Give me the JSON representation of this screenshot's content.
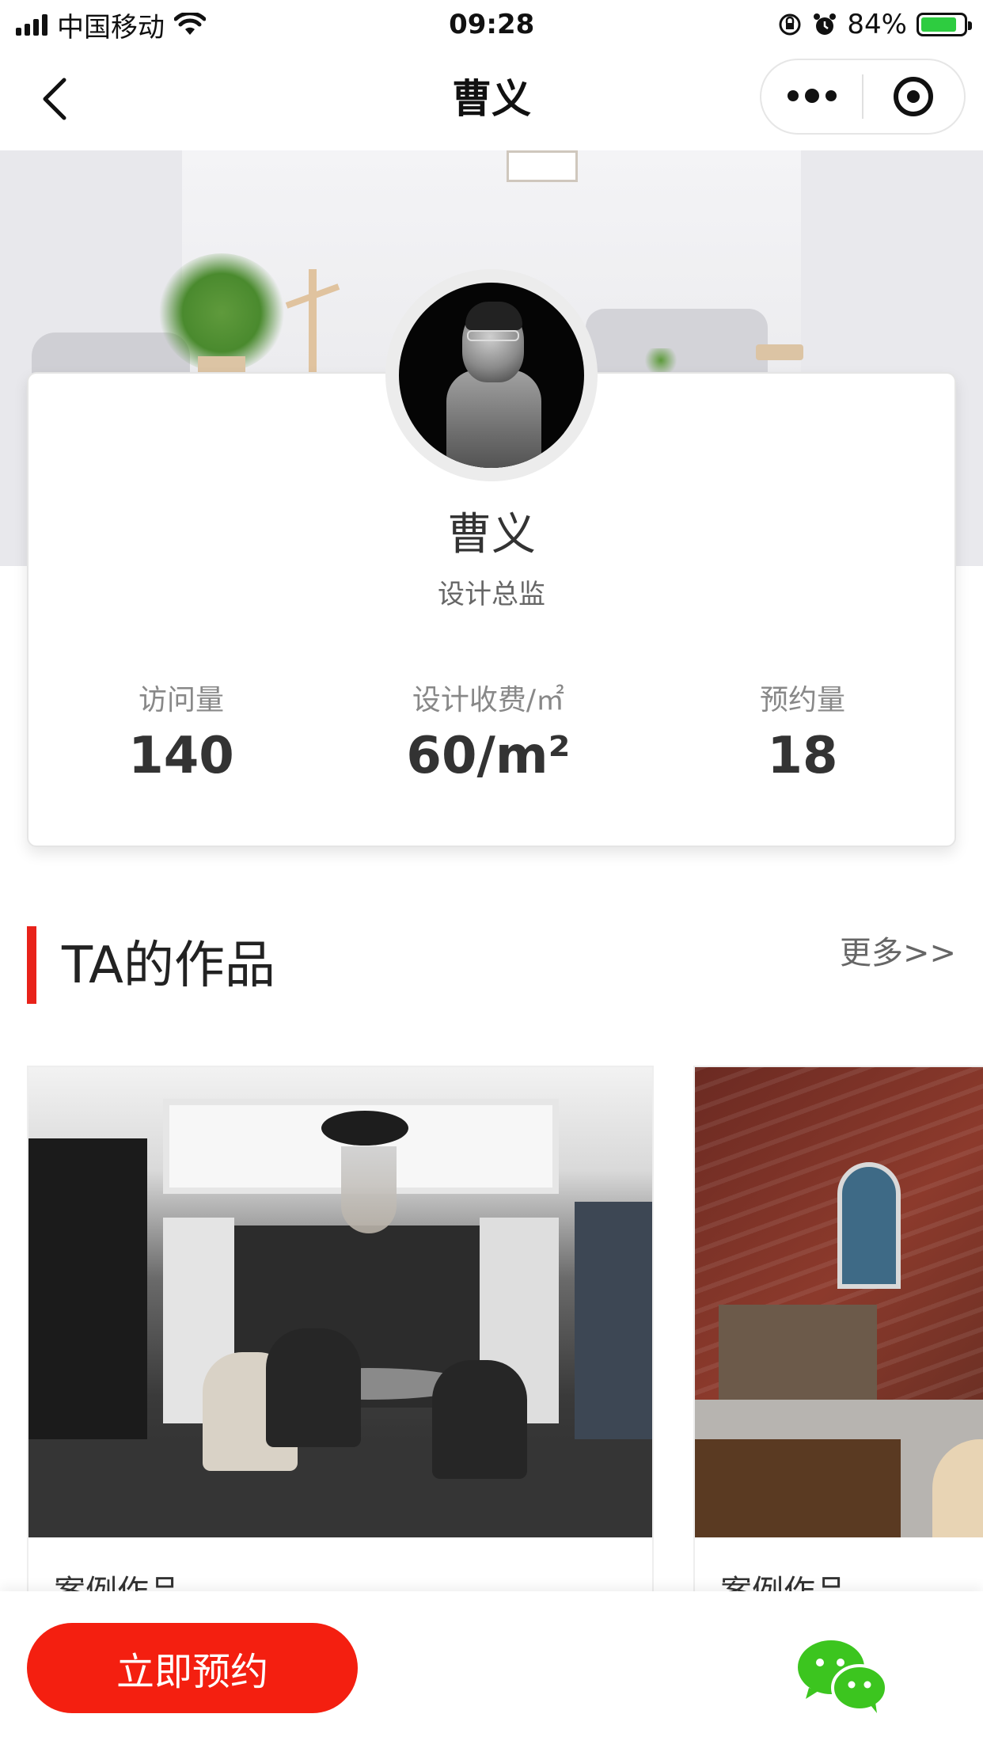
{
  "status_bar": {
    "carrier": "中国移动",
    "time": "09:28",
    "battery_percent": "84%",
    "battery_level": 0.84
  },
  "nav": {
    "title": "曹义",
    "icons": [
      "back-chevron-icon",
      "more-dots-icon",
      "close-target-icon"
    ]
  },
  "profile": {
    "name": "曹义",
    "role": "设计总监",
    "stats": [
      {
        "label": "访问量",
        "value": "140"
      },
      {
        "label": "设计收费/㎡",
        "value": "60/m²"
      },
      {
        "label": "预约量",
        "value": "18"
      }
    ]
  },
  "works_section": {
    "title": "TA的作品",
    "more": "更多>>",
    "items": [
      {
        "caption": "案例作品"
      },
      {
        "caption": "案例作品"
      }
    ]
  },
  "bottom_bar": {
    "book_label": "立即预约",
    "share_icon": "wechat-icon"
  },
  "colors": {
    "accent_red": "#f41f10",
    "section_bar": "#e8221a",
    "wechat_green": "#3cc51f"
  }
}
